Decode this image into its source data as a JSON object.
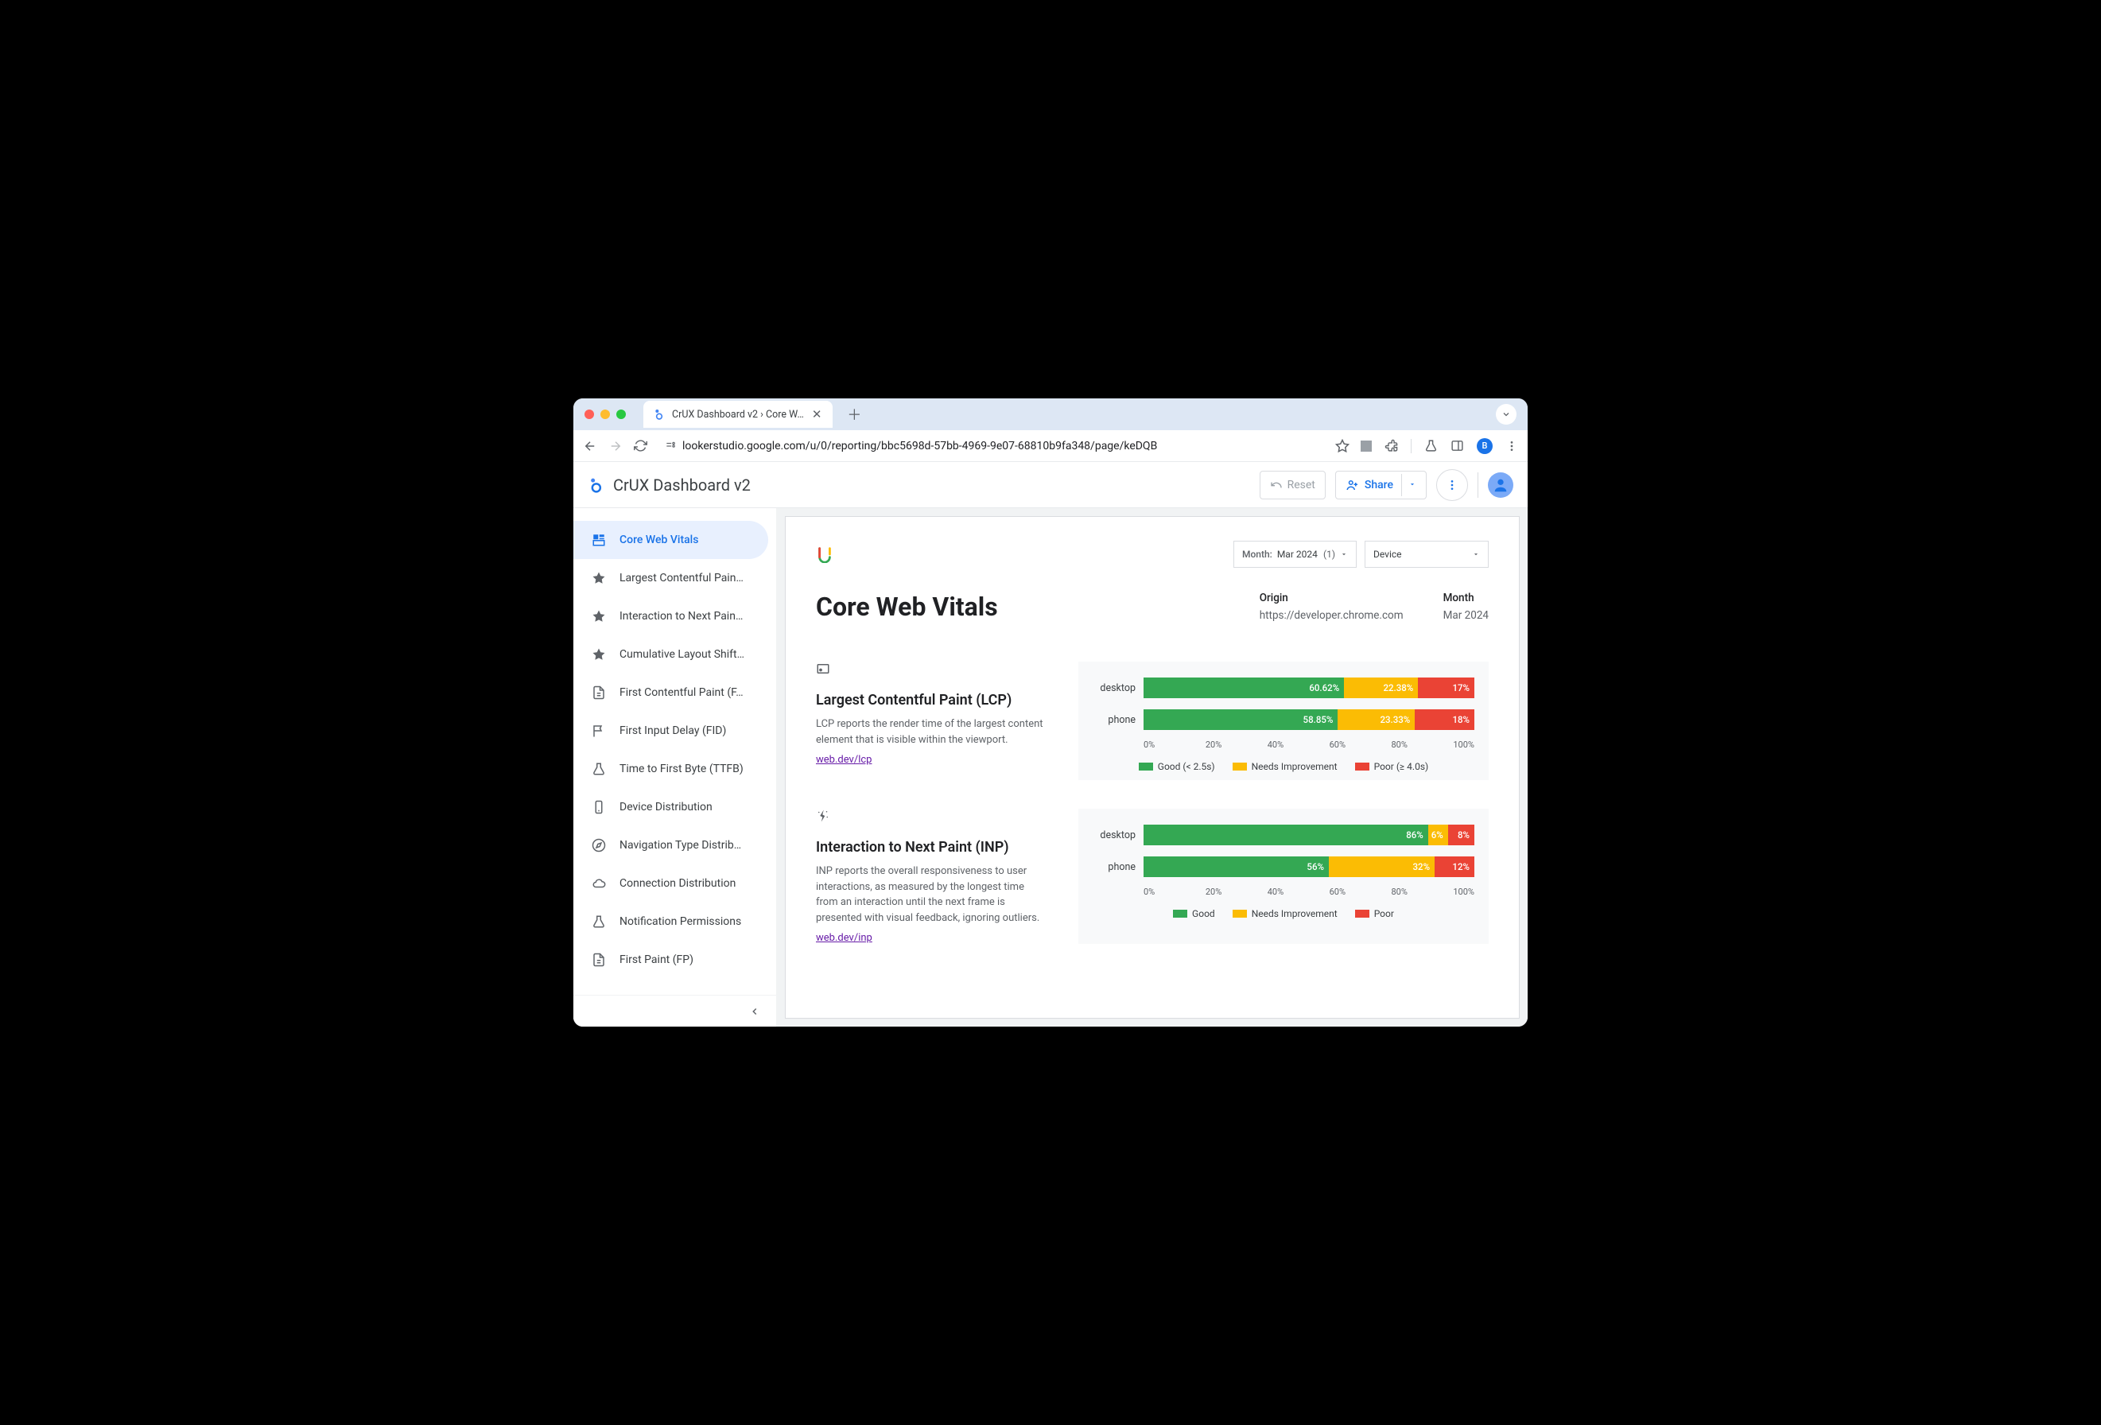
{
  "browser": {
    "tab_title": "CrUX Dashboard v2 › Core W…",
    "url": "lookerstudio.google.com/u/0/reporting/bbc5698d-57bb-4969-9e07-68810b9fa348/page/keDQB",
    "avatar_letter": "B"
  },
  "header": {
    "app_title": "CrUX Dashboard v2",
    "reset": "Reset",
    "share": "Share"
  },
  "sidebar": {
    "items": [
      {
        "label": "Core Web Vitals",
        "icon": "dashboard"
      },
      {
        "label": "Largest Contentful Pain…",
        "icon": "star"
      },
      {
        "label": "Interaction to Next Pain…",
        "icon": "star"
      },
      {
        "label": "Cumulative Layout Shift…",
        "icon": "star"
      },
      {
        "label": "First Contentful Paint (F…",
        "icon": "page"
      },
      {
        "label": "First Input Delay (FID)",
        "icon": "flag"
      },
      {
        "label": "Time to First Byte (TTFB)",
        "icon": "flask"
      },
      {
        "label": "Device Distribution",
        "icon": "device"
      },
      {
        "label": "Navigation Type Distrib…",
        "icon": "compass"
      },
      {
        "label": "Connection Distribution",
        "icon": "cloud"
      },
      {
        "label": "Notification Permissions",
        "icon": "flask"
      },
      {
        "label": "First Paint (FP)",
        "icon": "page"
      }
    ]
  },
  "filters": {
    "month_label": "Month:",
    "month_value": "Mar 2024",
    "month_count": "(1)",
    "device": "Device"
  },
  "page": {
    "title": "Core Web Vitals",
    "origin_h": "Origin",
    "origin_v": "https://developer.chrome.com",
    "month_h": "Month",
    "month_v": "Mar 2024"
  },
  "metrics": [
    {
      "title": "Largest Contentful Paint (LCP)",
      "desc": "LCP reports the render time of the largest content element that is visible within the viewport.",
      "link": "web.dev/lcp",
      "legend": {
        "good": "Good (< 2.5s)",
        "ni": "Needs Improvement",
        "poor": "Poor (≥ 4.0s)"
      }
    },
    {
      "title": "Interaction to Next Paint (INP)",
      "desc": "INP reports the overall responsiveness to user interactions, as measured by the longest time from an interaction until the next frame is presented with visual feedback, ignoring outliers.",
      "link": "web.dev/inp",
      "legend": {
        "good": "Good",
        "ni": "Needs Improvement",
        "poor": "Poor"
      }
    }
  ],
  "chart_data": [
    {
      "type": "bar",
      "stacked": true,
      "categories": [
        "desktop",
        "phone"
      ],
      "series": [
        {
          "name": "Good (< 2.5s)",
          "values": [
            60.62,
            58.85
          ],
          "labels": [
            "60.62%",
            "58.85%"
          ]
        },
        {
          "name": "Needs Improvement",
          "values": [
            22.38,
            23.33
          ],
          "labels": [
            "22.38%",
            "23.33%"
          ]
        },
        {
          "name": "Poor (≥ 4.0s)",
          "values": [
            17,
            18
          ],
          "labels": [
            "17%",
            "18%"
          ]
        }
      ],
      "xticks": [
        "0%",
        "20%",
        "40%",
        "60%",
        "80%",
        "100%"
      ]
    },
    {
      "type": "bar",
      "stacked": true,
      "categories": [
        "desktop",
        "phone"
      ],
      "series": [
        {
          "name": "Good",
          "values": [
            86,
            56
          ],
          "labels": [
            "86%",
            "56%"
          ]
        },
        {
          "name": "Needs Improvement",
          "values": [
            6,
            32
          ],
          "labels": [
            "6%",
            "32%"
          ]
        },
        {
          "name": "Poor",
          "values": [
            8,
            12
          ],
          "labels": [
            "8%",
            "12%"
          ]
        }
      ],
      "xticks": [
        "0%",
        "20%",
        "40%",
        "60%",
        "80%",
        "100%"
      ]
    }
  ]
}
